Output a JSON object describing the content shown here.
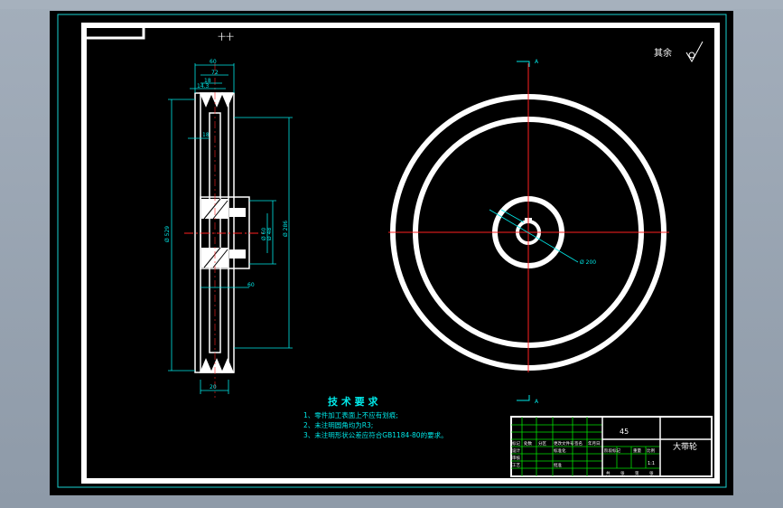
{
  "drawing": {
    "top_label": "十十",
    "roughness_note": "其余",
    "section_dims": {
      "top_width": "60",
      "groove_top": "72",
      "groove_mid": "18",
      "groove_pitch": "14.3",
      "web_thickness": "18",
      "overall_dia": "Ø 529",
      "hub_dia": "Ø 286",
      "bore_dia": "Ø 48",
      "bore_dia_2": "Ø 60",
      "hub_len": "60",
      "rim_width": "20"
    },
    "front_dims": {
      "hole_dia": "Ø 200"
    }
  },
  "tech_requirements": {
    "title": "技 术 要 求",
    "items": [
      "1、零件加工表面上不应有划痕;",
      "2、未注明圆角均为R3;",
      "3、未注明形状公差应符合GB1184-80的要求。"
    ]
  },
  "title_block": {
    "material": "45",
    "part_name": "大带轮",
    "scale": "1:1",
    "row_labels": [
      "标记",
      "处数",
      "分区",
      "更改文件号",
      "签名",
      "年月日"
    ],
    "stage_labels": [
      "阶段标记",
      "重量",
      "比例"
    ],
    "role_labels": [
      "设计",
      "标准化",
      "审核",
      "工艺",
      "批准"
    ],
    "sheet_labels": [
      "共",
      "张",
      "第",
      "张"
    ]
  },
  "colors": {
    "paper": "#000000",
    "border": "#ffffff",
    "sheet_outline": "#18d2d2",
    "centerline": "#ff2020",
    "dimension": "#00e8e8",
    "hatch": "#ffffff",
    "green_line": "#00e000"
  }
}
